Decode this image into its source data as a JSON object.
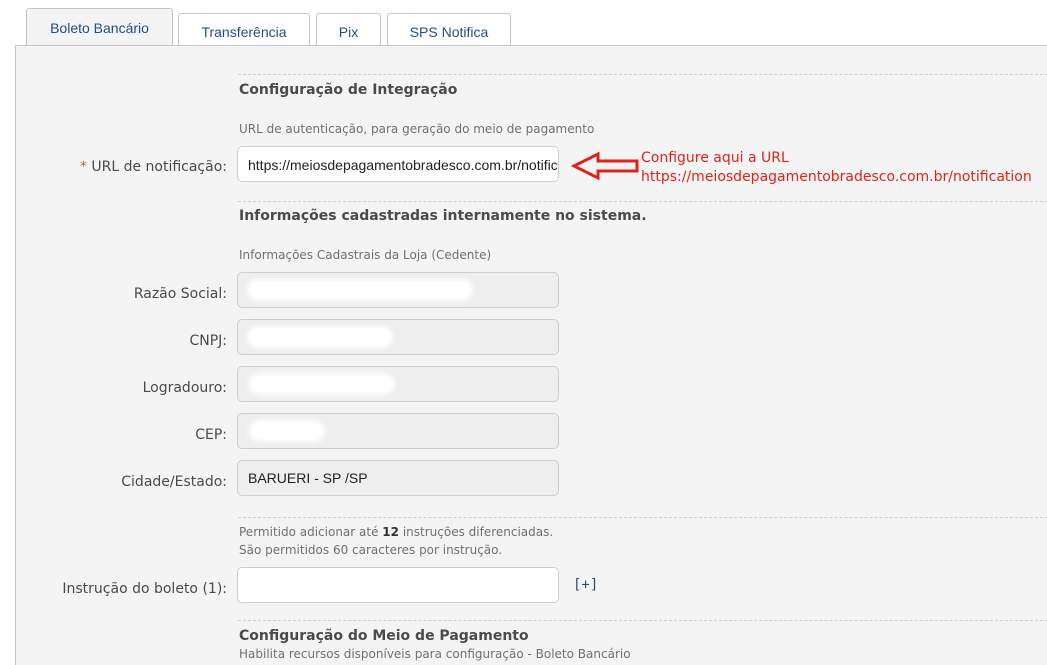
{
  "tabs": [
    {
      "label": "Boleto Bancário",
      "active": true
    },
    {
      "label": "Transferência",
      "active": false
    },
    {
      "label": "Pix",
      "active": false
    },
    {
      "label": "SPS Notifica",
      "active": false
    }
  ],
  "integration": {
    "title": "Configuração de Integração",
    "hint": "URL de autenticação, para geração do meio de pagamento",
    "required_mark": "*",
    "url_label": "URL de notificação:",
    "url_value": "https://meiosdepagamentobradesco.com.br/notification"
  },
  "annotation": {
    "line1": "Configure aqui a URL",
    "line2": "https://meiosdepagamentobradesco.com.br/notification",
    "color": "#e0231a"
  },
  "registry": {
    "title": "Informações cadastradas internamente no sistema.",
    "hint": "Informações Cadastrais da Loja (Cedente)",
    "fields": [
      {
        "label": "Razão Social:",
        "value": ""
      },
      {
        "label": "CNPJ:",
        "value": ""
      },
      {
        "label": "Logradouro:",
        "value": ""
      },
      {
        "label": "CEP:",
        "value": ""
      },
      {
        "label": "Cidade/Estado:",
        "value": "BARUERI - SP /SP"
      }
    ]
  },
  "instructions": {
    "hint1_pre": "Permitido adicionar até ",
    "hint1_num": "12",
    "hint1_post": " instruções diferenciadas.",
    "hint2": "São permitidos 60 caracteres por instrução.",
    "label": "Instrução do boleto (1):",
    "value": "",
    "add_label": "[+]"
  },
  "payment": {
    "title": "Configuração do Meio de Pagamento",
    "hint": "Habilita recursos disponíveis para configuração - Boleto Bancário"
  },
  "colors": {
    "link": "#1f4e8c",
    "panel_bg": "#f4f4f4",
    "required": "#d9534f"
  }
}
